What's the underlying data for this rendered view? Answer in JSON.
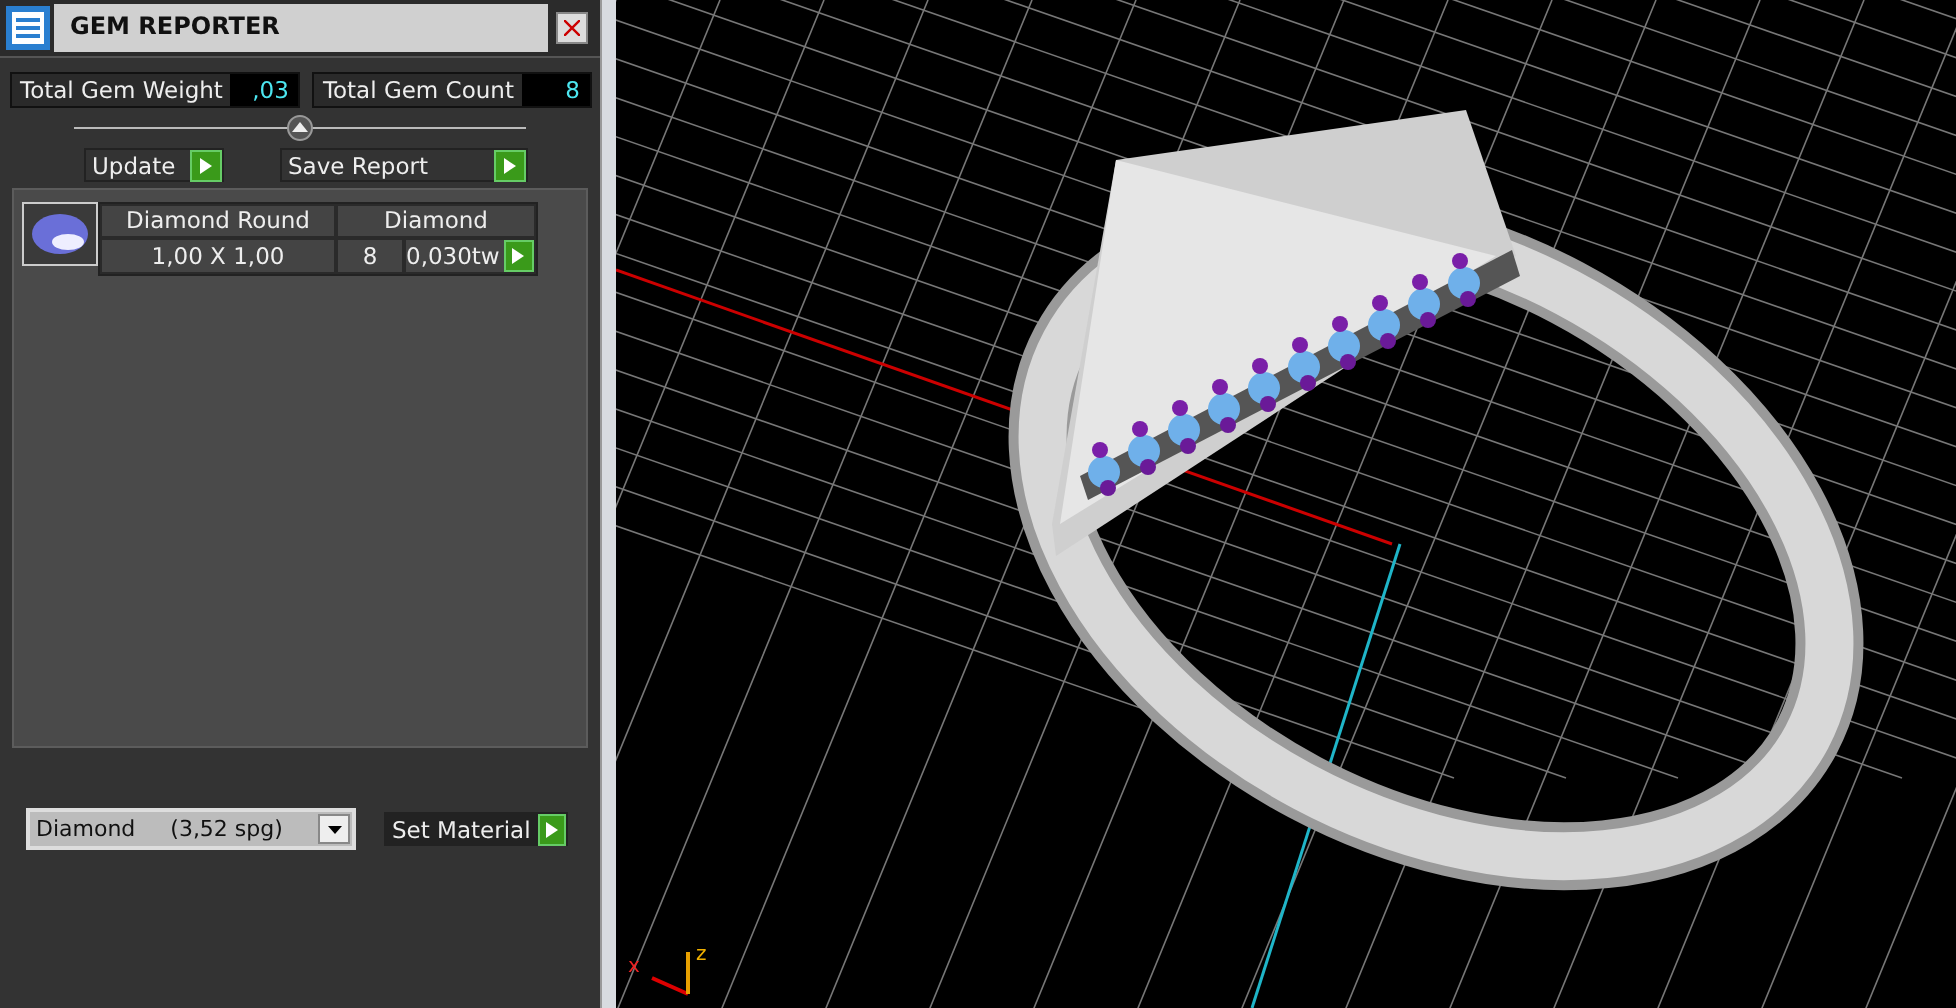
{
  "panel": {
    "title": "GEM REPORTER",
    "totals": [
      {
        "label": "Total Gem Weight",
        "value": ",03"
      },
      {
        "label": "Total Gem Count",
        "value": "8"
      }
    ],
    "buttons": [
      "Update",
      "Save Report"
    ],
    "gems": [
      {
        "name": "Diamond Round",
        "material": "Diamond",
        "size": "1,00 X 1,00",
        "count": "8",
        "weight": "0,030tw"
      }
    ],
    "material_select": {
      "value": "Diamond     (3,52 spg)"
    },
    "set_material_button": "Set Material"
  },
  "viewport": {
    "axis_labels": [
      "x",
      "z"
    ]
  }
}
